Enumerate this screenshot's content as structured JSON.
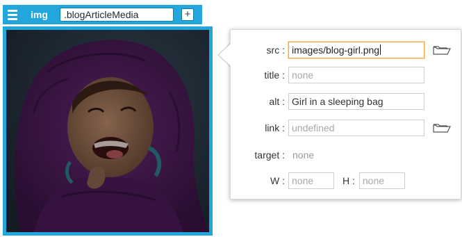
{
  "tag_bar": {
    "menu_icon": "hamburger-menu-icon",
    "element_tag": "img",
    "class_name": ".blogArticleMedia",
    "add_label": "+",
    "accent_color": "#22a6dc"
  },
  "image": {
    "alt": "Girl in a sleeping bag",
    "overlay": "dark translucent selection overlay"
  },
  "inspector": {
    "src": {
      "label": "src :",
      "value": "images/blog-girl.png",
      "icon": "folder-icon"
    },
    "title": {
      "label": "title :",
      "placeholder": "none"
    },
    "alt": {
      "label": "alt :",
      "value": "Girl in a sleeping bag"
    },
    "link": {
      "label": "link :",
      "placeholder": "undefined",
      "icon": "folder-icon"
    },
    "target": {
      "label": "target :",
      "value": "none"
    },
    "width": {
      "label": "W :",
      "placeholder": "none"
    },
    "height": {
      "label": "H :",
      "placeholder": "none"
    },
    "focus_color": "#f0b04a"
  }
}
